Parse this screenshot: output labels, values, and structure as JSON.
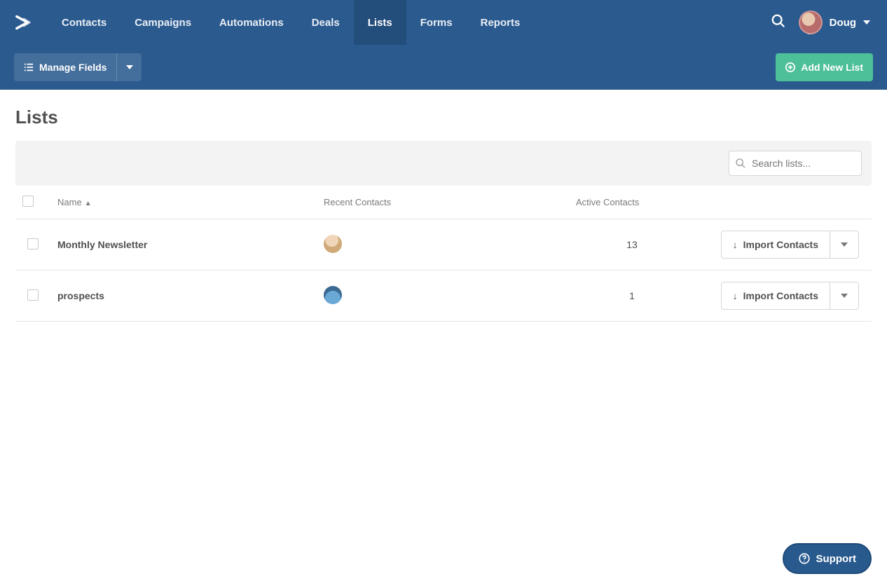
{
  "nav": {
    "items": [
      {
        "label": "Contacts"
      },
      {
        "label": "Campaigns"
      },
      {
        "label": "Automations"
      },
      {
        "label": "Deals"
      },
      {
        "label": "Lists"
      },
      {
        "label": "Forms"
      },
      {
        "label": "Reports"
      }
    ],
    "active_index": 4
  },
  "user": {
    "name": "Doug"
  },
  "toolbar": {
    "manage_fields_label": "Manage Fields",
    "add_new_list_label": "Add New List"
  },
  "page": {
    "title": "Lists",
    "search_placeholder": "Search lists..."
  },
  "table": {
    "columns": {
      "name": "Name",
      "recent": "Recent Contacts",
      "active": "Active Contacts"
    },
    "import_label": "Import Contacts",
    "rows": [
      {
        "name": "Monthly Newsletter",
        "active_contacts": "13"
      },
      {
        "name": "prospects",
        "active_contacts": "1"
      }
    ]
  },
  "support": {
    "label": "Support"
  }
}
